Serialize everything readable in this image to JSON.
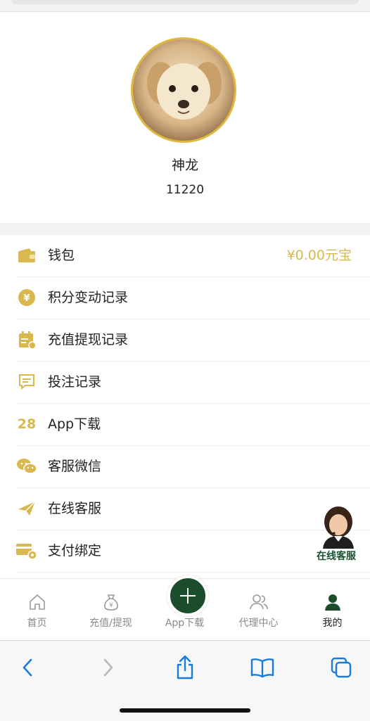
{
  "profile": {
    "name": "神龙",
    "id": "11220"
  },
  "menu": [
    {
      "label": "钱包",
      "value": "¥0.00元宝",
      "icon": "wallet-icon"
    },
    {
      "label": "积分变动记录",
      "icon": "coin-icon"
    },
    {
      "label": "充值提现记录",
      "icon": "calendar-icon"
    },
    {
      "label": "投注记录",
      "icon": "message-icon"
    },
    {
      "label": "App下载",
      "icon": "app-28-icon",
      "icon_text": "28"
    },
    {
      "label": "客服微信",
      "icon": "wechat-icon"
    },
    {
      "label": "在线客服",
      "icon": "paper-plane-icon"
    },
    {
      "label": "支付绑定",
      "icon": "card-gear-icon"
    }
  ],
  "float_service": {
    "label": "在线客服"
  },
  "tabbar": {
    "home": "首页",
    "recharge": "充值/提现",
    "app": "App下载",
    "agent": "代理中心",
    "mine": "我的",
    "active": "mine"
  },
  "colors": {
    "gold": "#d9b84f",
    "green": "#1b4d2c",
    "ios_blue": "#1a7bd8"
  }
}
